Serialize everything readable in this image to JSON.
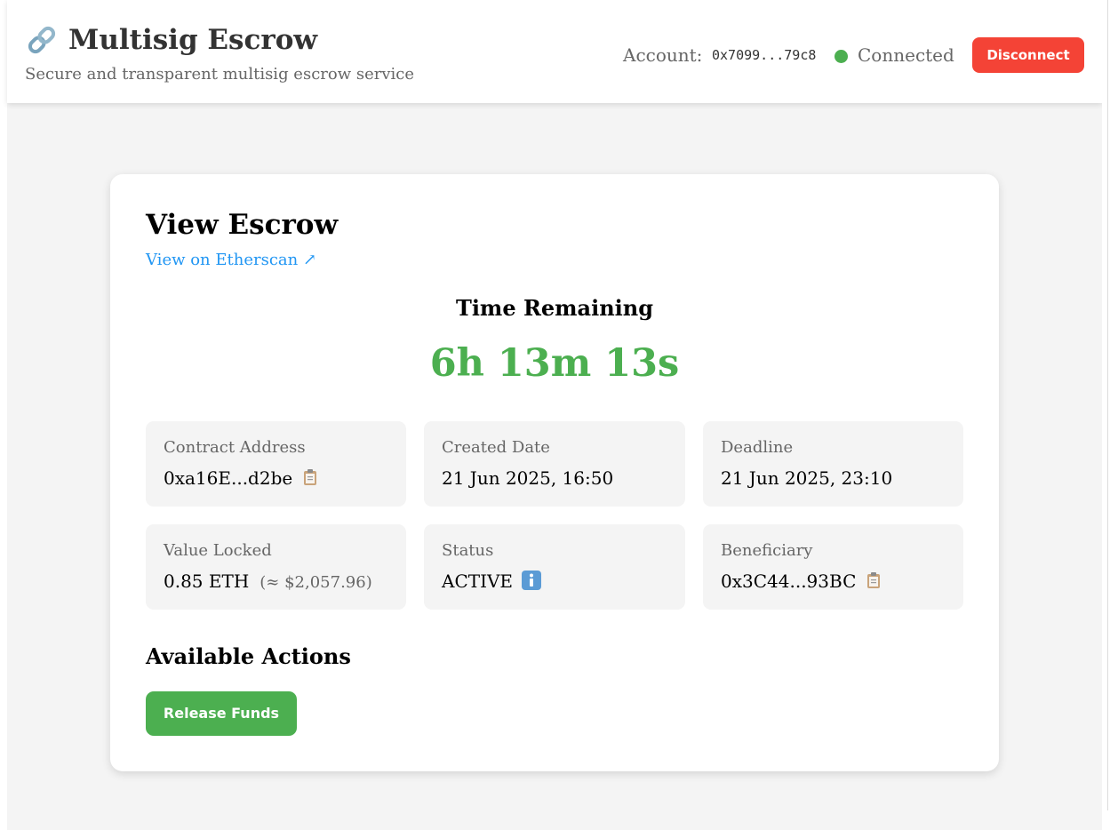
{
  "header": {
    "app_title": "Multisig Escrow",
    "subtitle": "Secure and transparent multisig escrow service",
    "account_label": "Account:",
    "account_address": "0x7099...79c8",
    "connection_status": "Connected",
    "disconnect_label": "Disconnect",
    "logo_icon": "link-icon"
  },
  "escrow": {
    "title": "View Escrow",
    "etherscan_link": "View on Etherscan ↗",
    "time_label": "Time Remaining",
    "countdown": "6h 13m 13s",
    "fields": [
      {
        "label": "Contract Address",
        "value": "0xa16E...d2be",
        "icon": "clipboard-icon"
      },
      {
        "label": "Created Date",
        "value": "21 Jun 2025, 16:50"
      },
      {
        "label": "Deadline",
        "value": "21 Jun 2025, 23:10"
      },
      {
        "label": "Value Locked",
        "value": "0.85 ETH",
        "secondary": "(≈ $2,057.96)"
      },
      {
        "label": "Status",
        "value": "ACTIVE",
        "icon": "info-icon"
      },
      {
        "label": "Beneficiary",
        "value": "0x3C44...93BC",
        "icon": "clipboard-icon"
      }
    ],
    "actions_title": "Available Actions",
    "release_label": "Release Funds"
  },
  "colors": {
    "page_background": "#f4f4f4",
    "accent_green": "#4caf50",
    "danger_red": "#f44336",
    "link_blue": "#2196f3",
    "muted_text": "#666666"
  }
}
